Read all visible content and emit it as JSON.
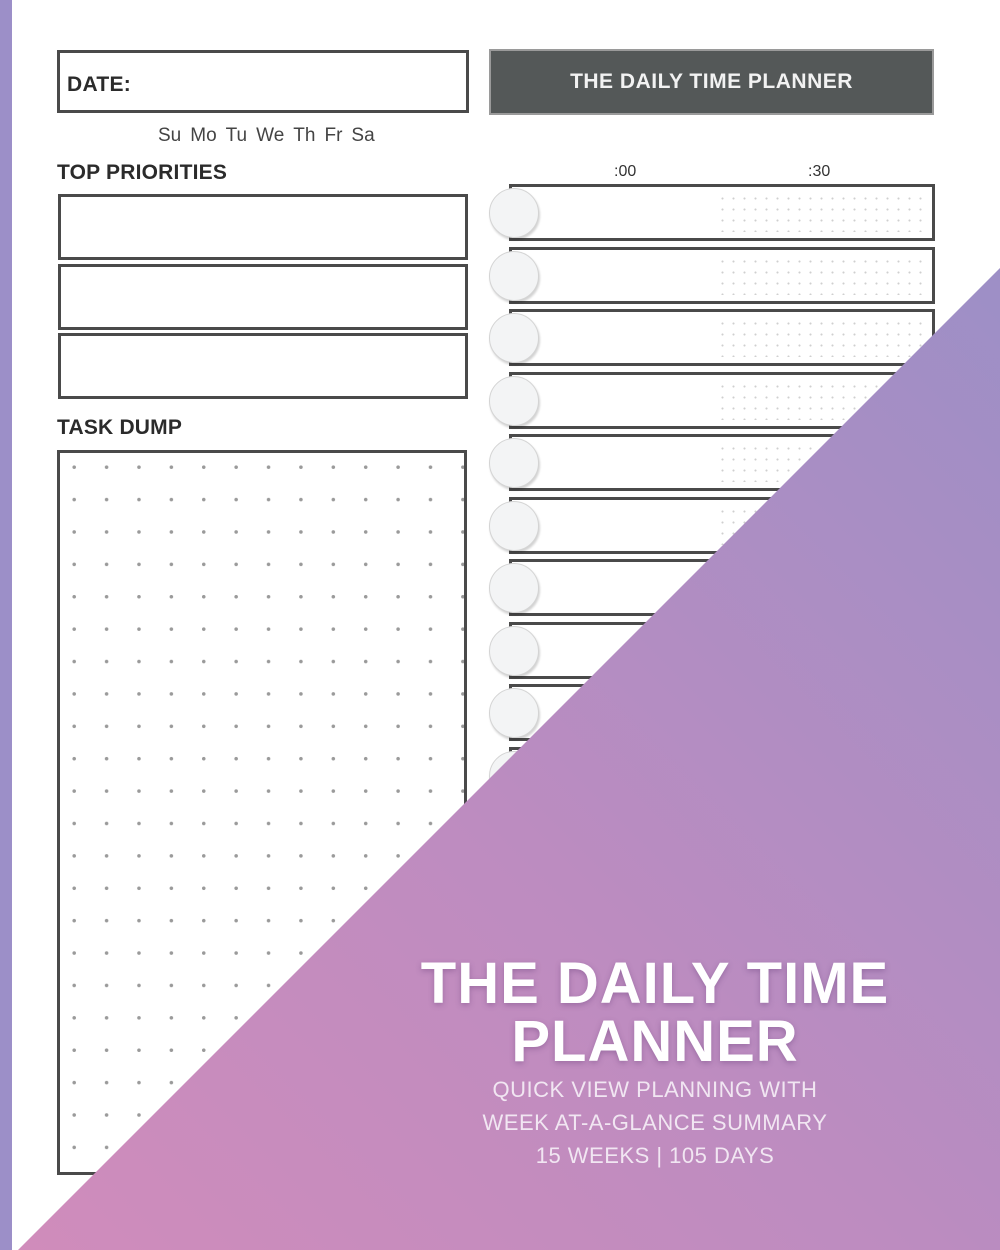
{
  "planner": {
    "date_label": "DATE:",
    "weekdays": [
      "Su",
      "Mo",
      "Tu",
      "We",
      "Th",
      "Fr",
      "Sa"
    ],
    "banner_title": "THE DAILY TIME PLANNER",
    "top_priorities_heading": "TOP PRIORITIES",
    "priority_slots": 3,
    "task_dump_heading": "TASK DUMP",
    "time_headers": [
      ":00",
      ":30"
    ],
    "hour_slot_count": 10
  },
  "cover": {
    "title_line1": "THE DAILY TIME",
    "title_line2": "PLANNER",
    "subtitle_line1": "QUICK VIEW PLANNING WITH",
    "subtitle_line2": "WEEK AT-A-GLANCE SUMMARY",
    "subtitle_line3": "15 WEEKS | 105 DAYS"
  },
  "colors": {
    "side_bar": "#9c8fc8",
    "banner_bg": "#545858",
    "gradient_top": "#9d8fc6",
    "gradient_bottom": "#d08cbb",
    "outline": "#4a4a4a"
  }
}
